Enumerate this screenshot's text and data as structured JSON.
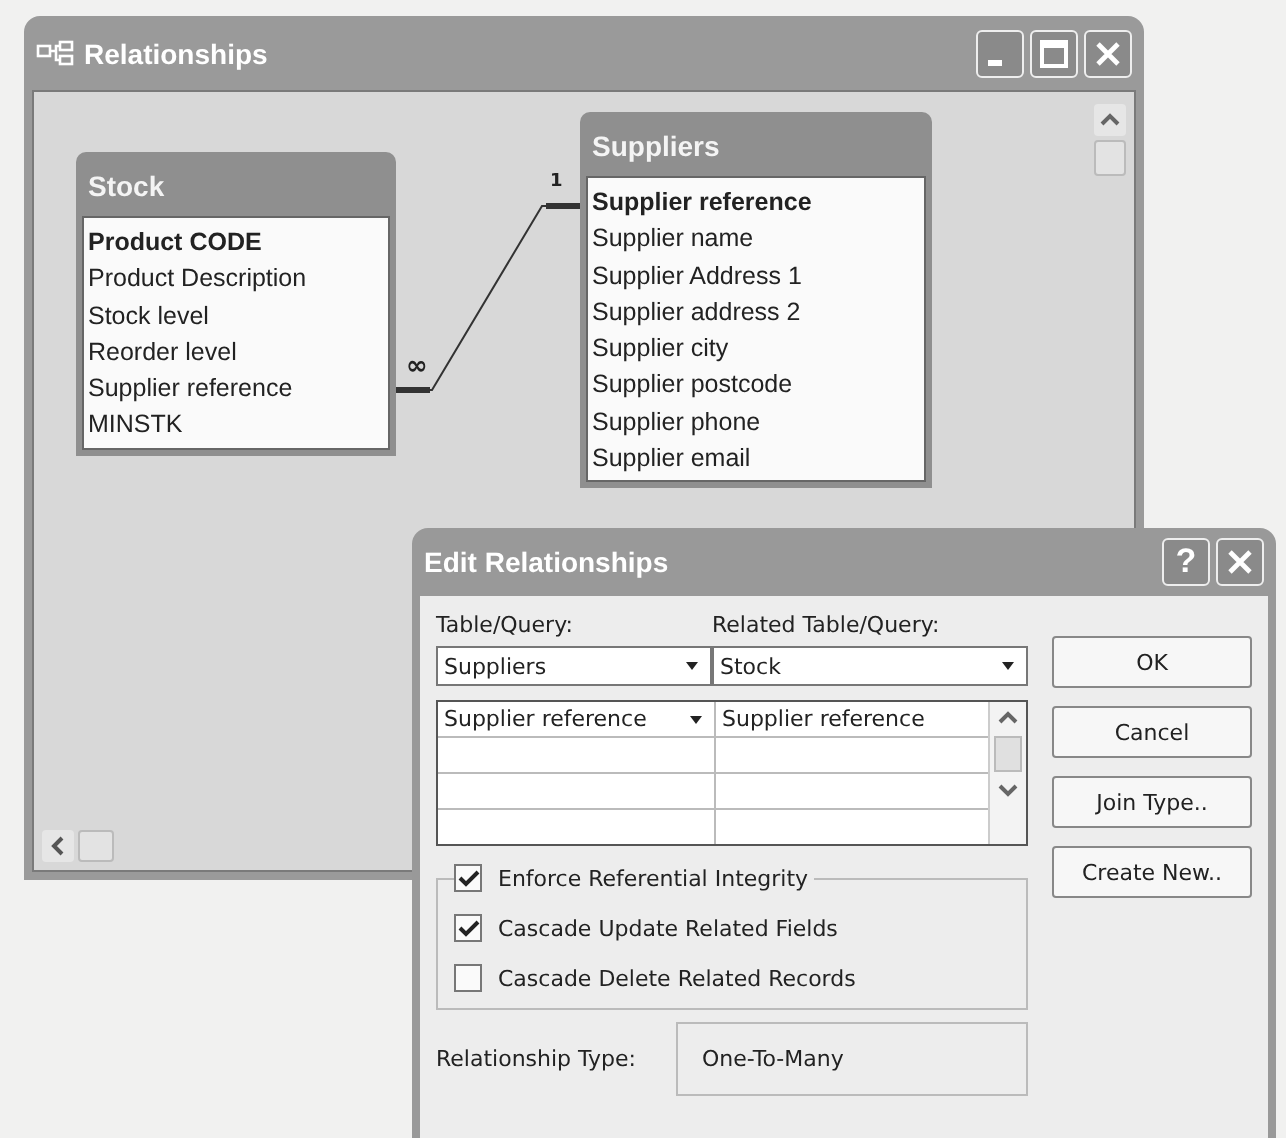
{
  "relationships_window": {
    "title": "Relationships",
    "tables": [
      {
        "name": "Stock",
        "fields": [
          {
            "name": "Product CODE",
            "primary_key": true
          },
          {
            "name": "Product Description",
            "primary_key": false
          },
          {
            "name": "Stock level",
            "primary_key": false
          },
          {
            "name": "Reorder level",
            "primary_key": false
          },
          {
            "name": "Supplier reference",
            "primary_key": false
          },
          {
            "name": "MINSTK",
            "primary_key": false
          }
        ]
      },
      {
        "name": "Suppliers",
        "fields": [
          {
            "name": "Supplier reference",
            "primary_key": true
          },
          {
            "name": "Supplier name",
            "primary_key": false
          },
          {
            "name": "Supplier Address 1",
            "primary_key": false
          },
          {
            "name": "Supplier address 2",
            "primary_key": false
          },
          {
            "name": "Supplier city",
            "primary_key": false
          },
          {
            "name": "Supplier postcode",
            "primary_key": false
          },
          {
            "name": "Supplier phone",
            "primary_key": false
          },
          {
            "name": "Supplier email",
            "primary_key": false
          }
        ]
      }
    ],
    "relationship": {
      "one_label": "1",
      "many_label": "∞"
    }
  },
  "dialog": {
    "title": "Edit Relationships",
    "help_button": "?",
    "table_query_label": "Table/Query:",
    "table_query": "Suppliers",
    "related_label": "Related Table/Query:",
    "related_table": "Stock",
    "join_fields": [
      {
        "left": "Supplier reference",
        "right": "Supplier reference"
      }
    ],
    "options": [
      {
        "label": "Enforce Referential Integrity",
        "checked": true
      },
      {
        "label": "Cascade Update Related Fields",
        "checked": true
      },
      {
        "label": "Cascade Delete Related Records",
        "checked": false
      }
    ],
    "relationship_type_label": "Relationship Type:",
    "relationship_type": "One-To-Many",
    "buttons": [
      "OK",
      "Cancel",
      "Join Type..",
      "Create New.."
    ]
  }
}
